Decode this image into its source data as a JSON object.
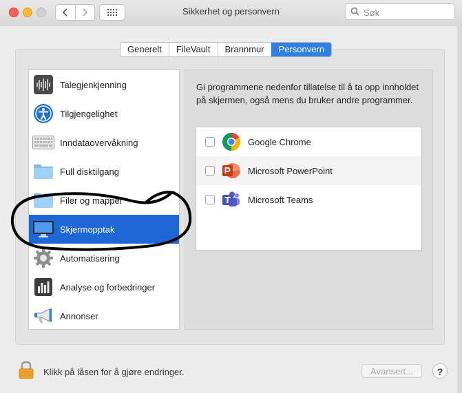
{
  "window": {
    "title": "Sikkerhet og personvern"
  },
  "search": {
    "placeholder": "Søk"
  },
  "tabs": [
    {
      "label": "Generelt"
    },
    {
      "label": "FileVault"
    },
    {
      "label": "Brannmur"
    },
    {
      "label": "Personvern",
      "active": true
    }
  ],
  "sidebar": {
    "items": [
      {
        "label": "Talegjenkjenning",
        "icon": "waveform-icon"
      },
      {
        "label": "Tilgjengelighet",
        "icon": "accessibility-icon"
      },
      {
        "label": "Inndataovervåkning",
        "icon": "keyboard-icon"
      },
      {
        "label": "Full disktilgang",
        "icon": "folder-icon"
      },
      {
        "label": "Filer og mapper",
        "icon": "folder-icon"
      },
      {
        "label": "Skjermopptak",
        "icon": "display-icon",
        "selected": true
      },
      {
        "label": "Automatisering",
        "icon": "gear-icon"
      },
      {
        "label": "Analyse og forbedringer",
        "icon": "bar-chart-icon"
      },
      {
        "label": "Annonser",
        "icon": "megaphone-icon"
      }
    ]
  },
  "main": {
    "description": "Gi programmene nedenfor tillatelse til å ta opp innholdet på skjermen, også mens du bruker andre programmer.",
    "apps": [
      {
        "name": "Google Chrome",
        "checked": false,
        "icon": "chrome-icon"
      },
      {
        "name": "Microsoft PowerPoint",
        "checked": false,
        "icon": "powerpoint-icon"
      },
      {
        "name": "Microsoft Teams",
        "checked": false,
        "icon": "teams-icon"
      }
    ]
  },
  "footer": {
    "lock_text": "Klikk på låsen for å gjøre endringer.",
    "advanced_label": "Avansert...",
    "help_label": "?"
  },
  "colors": {
    "accent": "#2f7fe5",
    "selection": "#1d67d6",
    "annotation": "#000000"
  }
}
